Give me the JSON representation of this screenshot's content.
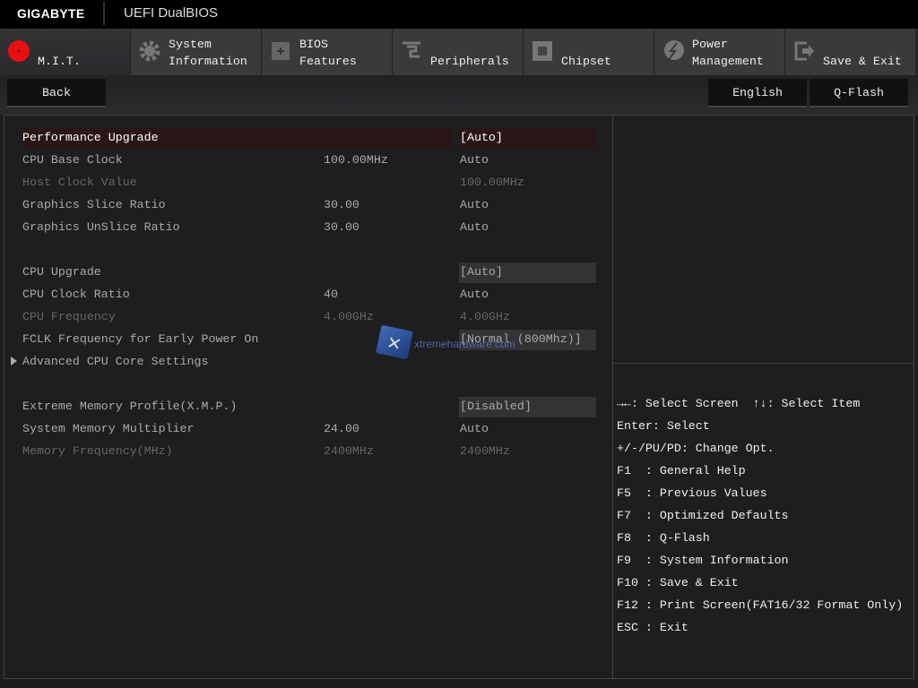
{
  "header": {
    "brand": "GIGABYTE",
    "product": "UEFI DualBIOS"
  },
  "tabs": [
    {
      "l1": "",
      "l2": "M.I.T.",
      "icon": "mit-dial-icon",
      "active": true
    },
    {
      "l1": "System",
      "l2": "Information",
      "icon": "gear-icon"
    },
    {
      "l1": "BIOS",
      "l2": "Features",
      "icon": "bios-chip-icon"
    },
    {
      "l1": "",
      "l2": "Peripherals",
      "icon": "peripherals-icon"
    },
    {
      "l1": "",
      "l2": "Chipset",
      "icon": "chipset-icon"
    },
    {
      "l1": "Power",
      "l2": "Management",
      "icon": "power-bolt-icon"
    },
    {
      "l1": "",
      "l2": "Save & Exit",
      "icon": "exit-icon"
    }
  ],
  "toolbar": {
    "back": "Back",
    "language": "English",
    "qflash": "Q-Flash"
  },
  "settings": [
    {
      "label": "Performance Upgrade",
      "current": "",
      "value": "[Auto]",
      "state": "selected",
      "box": true
    },
    {
      "label": "CPU Base Clock",
      "current": "100.00MHz",
      "value": "Auto",
      "state": "normal"
    },
    {
      "label": "Host Clock Value",
      "current": "",
      "value": "100.00MHz",
      "state": "disabled"
    },
    {
      "label": "Graphics Slice Ratio",
      "current": "30.00",
      "value": "Auto",
      "state": "normal"
    },
    {
      "label": "Graphics UnSlice Ratio",
      "current": "30.00",
      "value": "Auto",
      "state": "normal"
    },
    null,
    {
      "label": "CPU Upgrade",
      "current": "",
      "value": "[Auto]",
      "state": "normal",
      "box": true
    },
    {
      "label": "CPU Clock Ratio",
      "current": "40",
      "value": "Auto",
      "state": "normal"
    },
    {
      "label": "CPU Frequency",
      "current": "4.00GHz",
      "value": "4.00GHz",
      "state": "disabled"
    },
    {
      "label": "FCLK Frequency for Early Power On",
      "current": "",
      "value": "[Normal (800Mhz)]",
      "state": "normal",
      "box": true
    },
    {
      "label": "Advanced CPU Core Settings",
      "current": "",
      "value": "",
      "state": "submenu"
    },
    null,
    {
      "label": "Extreme Memory Profile(X.M.P.)",
      "current": "",
      "value": "[Disabled]",
      "state": "normal",
      "box": true
    },
    {
      "label": "System Memory Multiplier",
      "current": "24.00",
      "value": "Auto",
      "state": "normal"
    },
    {
      "label": "Memory Frequency(MHz)",
      "current": "2400MHz",
      "value": "2400MHz",
      "state": "disabled"
    }
  ],
  "help": [
    "→←: Select Screen  ↑↓: Select Item",
    "Enter: Select",
    "+/-/PU/PD: Change Opt.",
    "F1  : General Help",
    "F5  : Previous Values",
    "F7  : Optimized Defaults",
    "F8  : Q-Flash",
    "F9  : System Information",
    "F10 : Save & Exit",
    "F12 : Print Screen(FAT16/32 Format Only)",
    "ESC : Exit"
  ],
  "watermark": "xtremehardware.com"
}
